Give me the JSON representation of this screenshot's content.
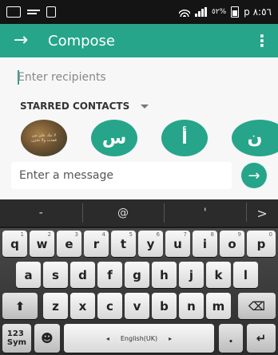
{
  "status_bar": {
    "left_icons": [
      "gallery-icon",
      "mail-icon",
      "document-icon"
    ],
    "battery_text": "٥٢%",
    "time": "p ٨:٥٦"
  },
  "app_bar": {
    "title": "Compose",
    "back_icon": "arrow-right-icon",
    "menu_icon": "overflow-menu-icon"
  },
  "recipients": {
    "placeholder": "Enter recipients"
  },
  "starred": {
    "header": "STARRED CONTACTS",
    "contacts": [
      {
        "initial": "",
        "kind": "photo",
        "photo_text": "لا تبك على من فقدت ولا تحزن"
      },
      {
        "initial": "س",
        "kind": "letter"
      },
      {
        "initial": "أ",
        "kind": "letter"
      },
      {
        "initial": "ن",
        "kind": "letter"
      }
    ]
  },
  "message": {
    "placeholder": "Enter a message",
    "send_icon": "arrow-right-icon"
  },
  "keyboard": {
    "suggestions": [
      "-",
      "@",
      "'",
      ">"
    ],
    "rows": [
      [
        {
          "label": "q",
          "hint": "1"
        },
        {
          "label": "w",
          "hint": "2"
        },
        {
          "label": "e",
          "hint": "3"
        },
        {
          "label": "r",
          "hint": "4"
        },
        {
          "label": "t",
          "hint": "5"
        },
        {
          "label": "y",
          "hint": "6"
        },
        {
          "label": "u",
          "hint": "7"
        },
        {
          "label": "i",
          "hint": "8"
        },
        {
          "label": "o",
          "hint": "9"
        },
        {
          "label": "p",
          "hint": "0"
        }
      ],
      [
        {
          "label": "a"
        },
        {
          "label": "s"
        },
        {
          "label": "d"
        },
        {
          "label": "f"
        },
        {
          "label": "g"
        },
        {
          "label": "h"
        },
        {
          "label": "j"
        },
        {
          "label": "k"
        },
        {
          "label": "l"
        }
      ],
      [
        {
          "label": "⬆",
          "name": "shift-key"
        },
        {
          "label": "z"
        },
        {
          "label": "x"
        },
        {
          "label": "c"
        },
        {
          "label": "v"
        },
        {
          "label": "b"
        },
        {
          "label": "n"
        },
        {
          "label": "m"
        },
        {
          "label": "⌫",
          "name": "backspace-key"
        }
      ]
    ],
    "bottom": {
      "sym_label": "123\nSym",
      "emoji_icon": "emoji-icon",
      "space_label": "English(UK)",
      "period_label": ".",
      "enter_label": "↵"
    }
  },
  "colors": {
    "accent": "#26a58a",
    "status_bar": "#141414",
    "keyboard_bg": "#1a1a1a"
  }
}
